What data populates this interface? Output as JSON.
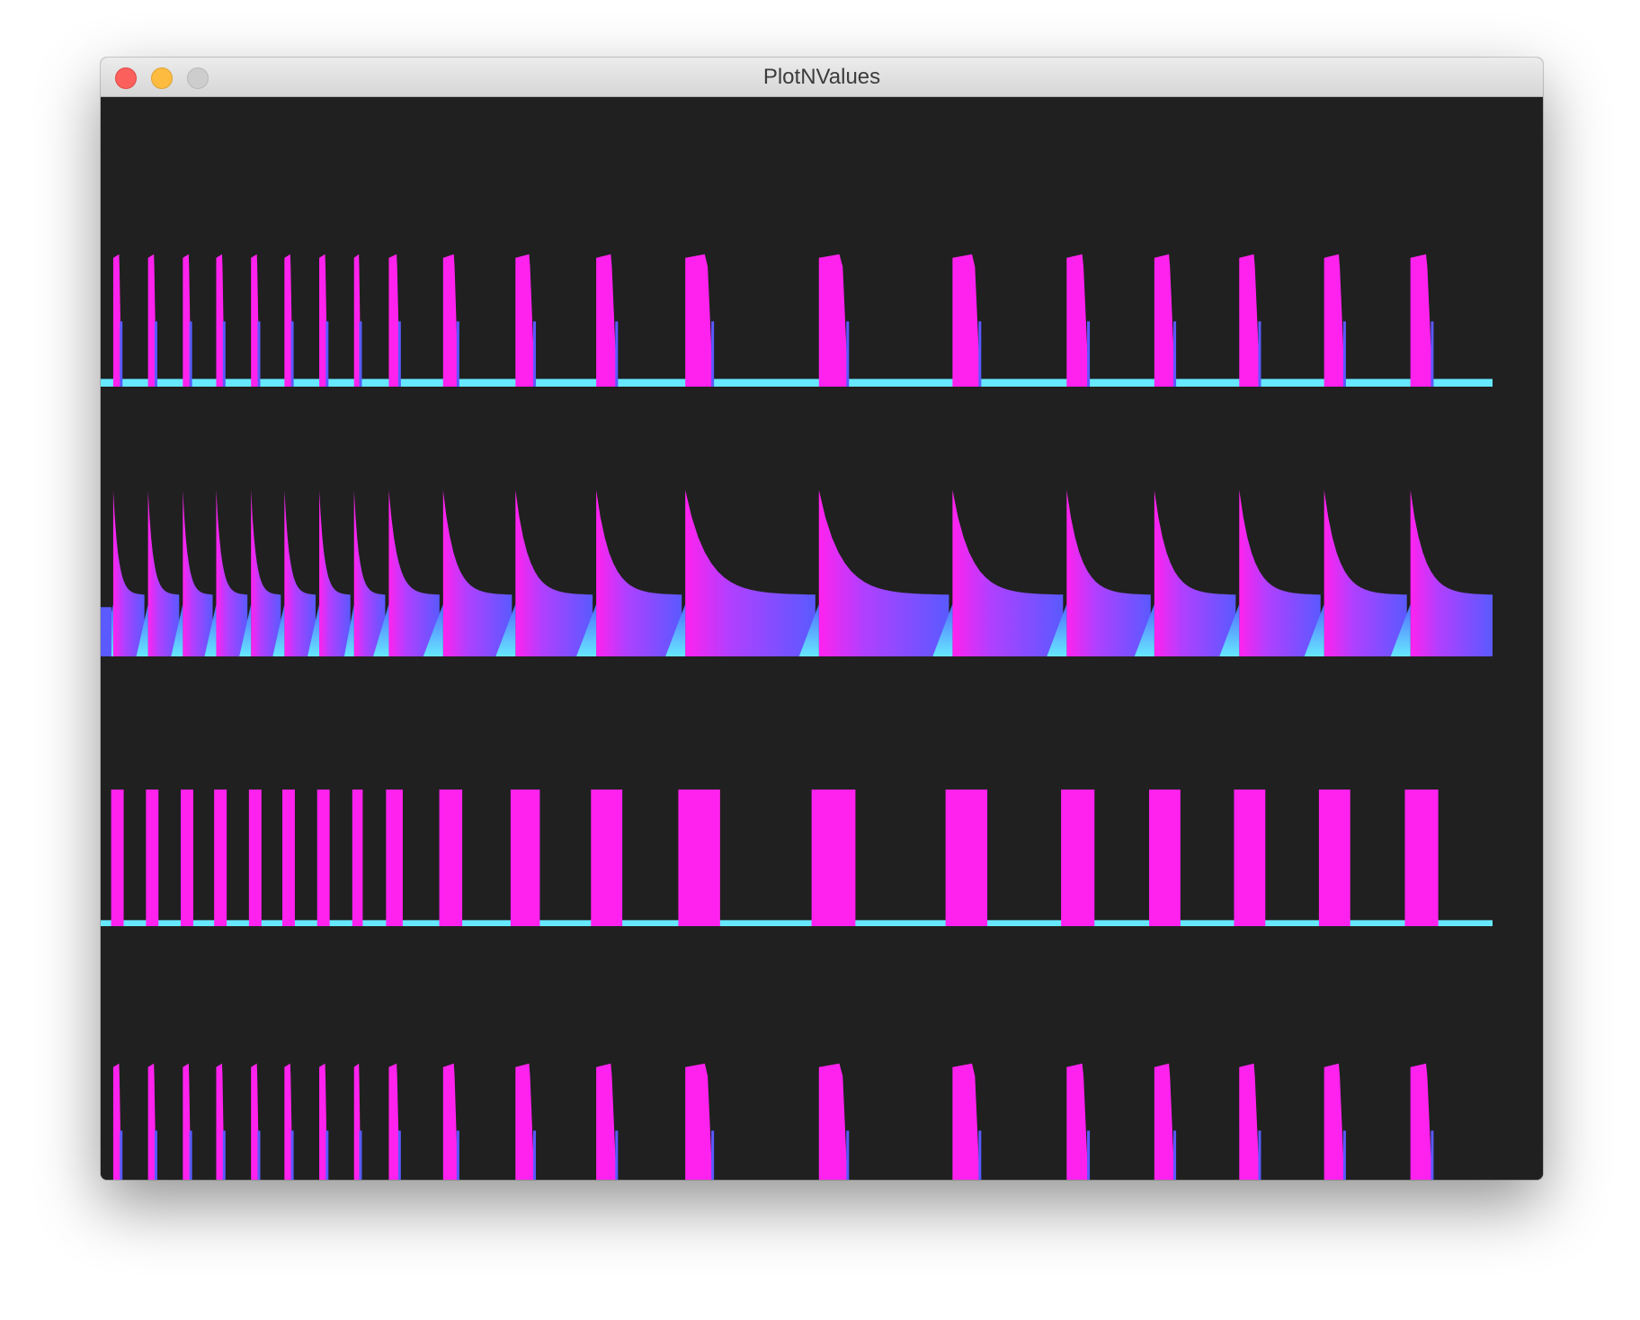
{
  "window": {
    "title": "PlotNValues",
    "buttons": {
      "close": "close",
      "minimize": "minimize",
      "zoom": "zoom"
    }
  },
  "colors": {
    "background": "#202020",
    "pulse": "#ff22ee",
    "baseline": "#66e8ff",
    "decay": "#5a5aff"
  },
  "chart_data": {
    "type": "area",
    "title": "",
    "xlabel": "",
    "ylabel": "",
    "grid": false,
    "legend": "none",
    "xlim": [
      0,
      1000
    ],
    "ylim": [
      0,
      1
    ],
    "pulses": [
      {
        "start": 9,
        "width": 6
      },
      {
        "start": 34,
        "width": 6
      },
      {
        "start": 59,
        "width": 6
      },
      {
        "start": 83,
        "width": 6
      },
      {
        "start": 108,
        "width": 6
      },
      {
        "start": 132,
        "width": 6
      },
      {
        "start": 157,
        "width": 6
      },
      {
        "start": 182,
        "width": 5
      },
      {
        "start": 207,
        "width": 8
      },
      {
        "start": 246,
        "width": 11
      },
      {
        "start": 298,
        "width": 14
      },
      {
        "start": 356,
        "width": 15
      },
      {
        "start": 420,
        "width": 20
      },
      {
        "start": 516,
        "width": 21
      },
      {
        "start": 612,
        "width": 20
      },
      {
        "start": 694,
        "width": 16
      },
      {
        "start": 757,
        "width": 15
      },
      {
        "start": 818,
        "width": 15
      },
      {
        "start": 879,
        "width": 15
      },
      {
        "start": 941,
        "width": 16
      }
    ],
    "series": [
      {
        "kind": "pulse",
        "peak": 0.88,
        "baseline": 0.04
      },
      {
        "kind": "decay",
        "peak": 1.0,
        "plateau": 0.37,
        "baseline": 0.0
      },
      {
        "kind": "square",
        "peak": 0.98,
        "baseline": 0.03
      },
      {
        "kind": "pulse",
        "peak": 0.88,
        "baseline": 0.04
      }
    ]
  }
}
